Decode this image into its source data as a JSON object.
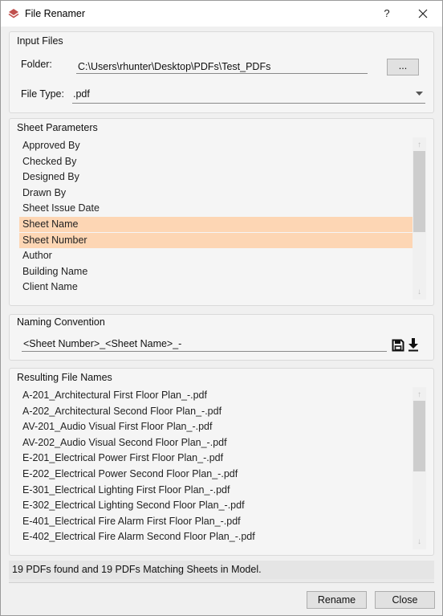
{
  "window": {
    "title": "File Renamer",
    "help_label": "?",
    "close_label": "✕"
  },
  "input_files": {
    "group_label": "Input Files",
    "folder_label": "Folder:",
    "folder_value": "C:\\Users\\rhunter\\Desktop\\PDFs\\Test_PDFs",
    "browse_label": "...",
    "filetype_label": "File Type:",
    "filetype_value": ".pdf"
  },
  "sheet_parameters": {
    "group_label": "Sheet Parameters",
    "items": [
      {
        "label": "Approved By",
        "selected": false
      },
      {
        "label": "Checked By",
        "selected": false
      },
      {
        "label": "Designed By",
        "selected": false
      },
      {
        "label": "Drawn By",
        "selected": false
      },
      {
        "label": "Sheet Issue Date",
        "selected": false
      },
      {
        "label": "Sheet Name",
        "selected": true
      },
      {
        "label": "Sheet Number",
        "selected": true
      },
      {
        "label": "Author",
        "selected": false
      },
      {
        "label": "Building Name",
        "selected": false
      },
      {
        "label": "Client Name",
        "selected": false
      }
    ]
  },
  "naming_convention": {
    "group_label": "Naming Convention",
    "value": "<Sheet Number>_<Sheet Name>_-",
    "save_icon": "save-icon",
    "download_icon": "download-icon"
  },
  "resulting_files": {
    "group_label": "Resulting File Names",
    "items": [
      "A-201_Architectural First Floor Plan_-.pdf",
      "A-202_Architectural Second Floor Plan_-.pdf",
      "AV-201_Audio Visual First Floor Plan_-.pdf",
      "AV-202_Audio Visual Second Floor Plan_-.pdf",
      "E-201_Electrical Power First Floor Plan_-.pdf",
      "E-202_Electrical Power Second Floor Plan_-.pdf",
      "E-301_Electrical Lighting First Floor Plan_-.pdf",
      "E-302_Electrical Lighting Second Floor Plan_-.pdf",
      "E-401_Electrical Fire Alarm First Floor Plan_-.pdf",
      "E-402_Electrical Fire Alarm Second Floor Plan_-.pdf"
    ]
  },
  "status": {
    "message": "19 PDFs found and 19 PDFs Matching Sheets in Model."
  },
  "footer": {
    "rename_label": "Rename",
    "close_label": "Close"
  },
  "colors": {
    "selection": "#fdd6b4",
    "app_icon": "#c0504d"
  }
}
